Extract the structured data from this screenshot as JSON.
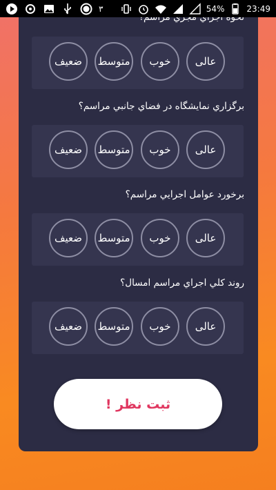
{
  "status_bar": {
    "notification_count": "۳",
    "battery": "54%",
    "time": "23:49"
  },
  "survey": {
    "questions": [
      {
        "text": "نحوه اجراي مجري مراسم؟",
        "options": [
          "عالی",
          "خوب",
          "متوسط",
          "ضعیف"
        ]
      },
      {
        "text": "برگزاري نمايشگاه در فضاي جانبي مراسم؟",
        "options": [
          "عالی",
          "خوب",
          "متوسط",
          "ضعیف"
        ]
      },
      {
        "text": "برخورد عوامل اجرايي مراسم؟",
        "options": [
          "عالی",
          "خوب",
          "متوسط",
          "ضعیف"
        ]
      },
      {
        "text": "روند كلي اجراي مراسم امسال؟",
        "options": [
          "عالی",
          "خوب",
          "متوسط",
          "ضعیف"
        ]
      }
    ],
    "submit_label": "ثبت نظر !"
  },
  "colors": {
    "card_background": "#2c2c44",
    "row_background": "#35354f",
    "option_border": "#8e8ea4",
    "submit_text": "#e0365f"
  }
}
